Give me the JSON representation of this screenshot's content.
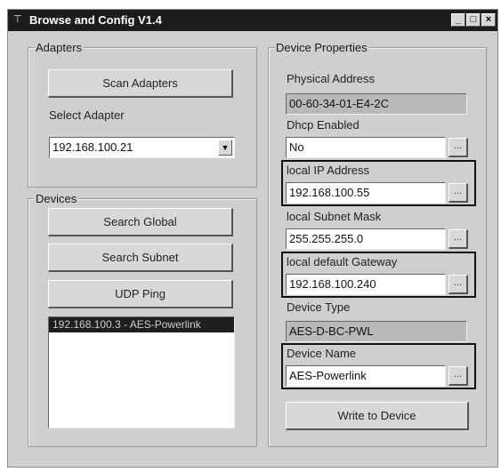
{
  "window": {
    "title": "Browse and Config V1.4",
    "controls": {
      "minimize": "_",
      "maximize": "□",
      "close": "×"
    }
  },
  "adapters": {
    "group_title": "Adapters",
    "scan_label": "Scan Adapters",
    "select_label": "Select Adapter",
    "selected_value": "192.168.100.21"
  },
  "devices": {
    "group_title": "Devices",
    "search_global_label": "Search Global",
    "search_subnet_label": "Search Subnet",
    "udp_ping_label": "UDP Ping",
    "list_items": [
      "192.168.100.3 - AES-Powerlink"
    ],
    "selected_index": 0
  },
  "properties": {
    "group_title": "Device Properties",
    "physical_address": {
      "label": "Physical Address",
      "value": "00-60-34-01-E4-2C"
    },
    "dhcp": {
      "label": "Dhcp Enabled",
      "value": "No"
    },
    "ip": {
      "label": "local IP Address",
      "value": "192.168.100.55"
    },
    "subnet": {
      "label": "local Subnet Mask",
      "value": "255.255.255.0"
    },
    "gateway": {
      "label": "local default Gateway",
      "value": "192.168.100.240"
    },
    "device_type": {
      "label": "Device Type",
      "value": "AES-D-BC-PWL"
    },
    "device_name": {
      "label": "Device Name",
      "value": "AES-Powerlink"
    },
    "edit_button_label": "...",
    "write_label": "Write to Device"
  }
}
